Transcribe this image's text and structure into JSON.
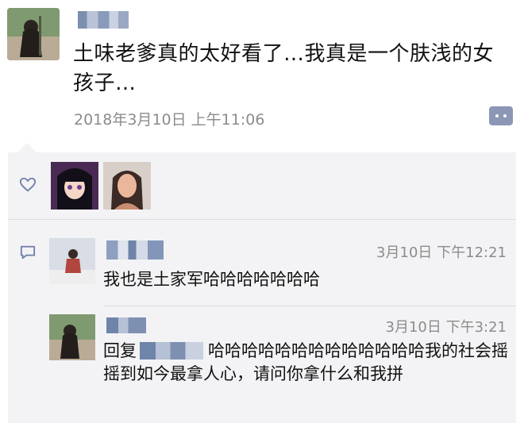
{
  "post": {
    "text": "土味老爹真的太好看了…我真是一个肤浅的女孩子…",
    "timestamp": "2018年3月10日 上午11:06"
  },
  "comments": [
    {
      "time": "3月10日 下午12:21",
      "text": "我也是土家军哈哈哈哈哈哈哈"
    },
    {
      "time": "3月10日 下午3:21",
      "reply_prefix": "回复",
      "text": "哈哈哈哈哈哈哈哈哈哈哈哈哈我的社会摇摇到如今最拿人心，请问你拿什么和我拼"
    }
  ],
  "icons": {
    "like": "heart-outline-icon",
    "comment": "speech-bubble-icon",
    "more": "comment-menu-icon"
  },
  "colors": {
    "background": "#ffffff",
    "panel": "#f3f3f5",
    "secondary_text": "#8c8c8c",
    "accent": "#8c97b5"
  }
}
